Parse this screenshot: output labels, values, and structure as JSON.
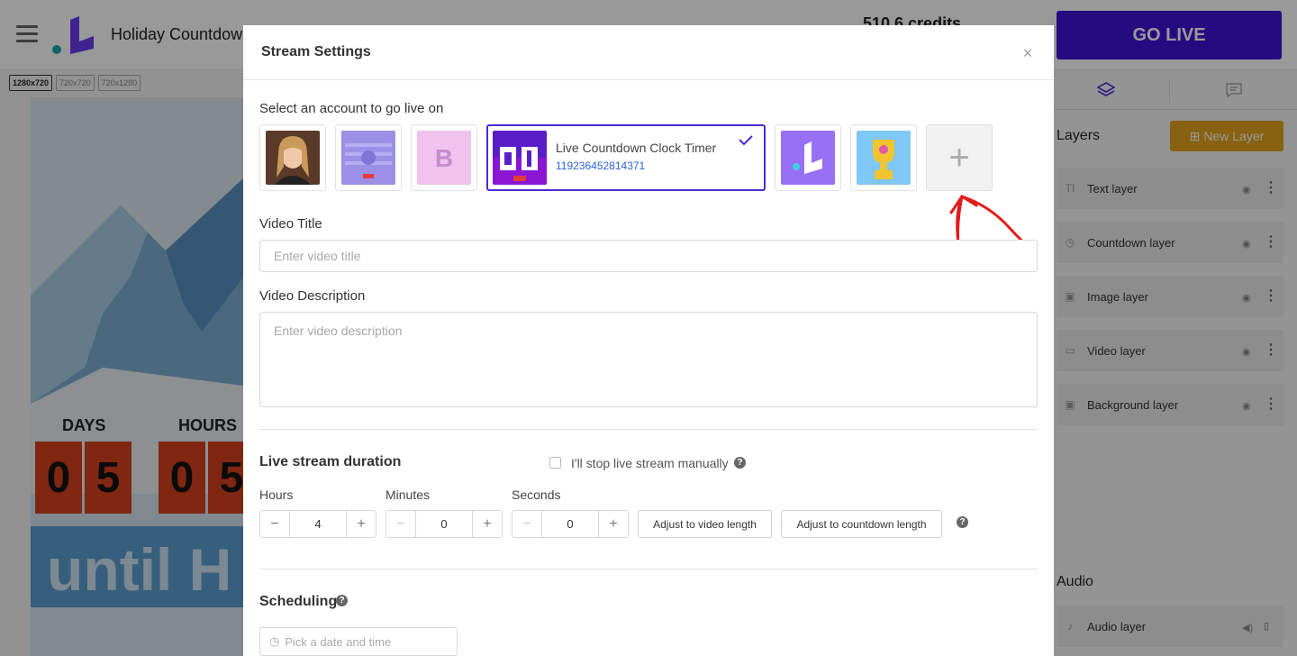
{
  "app": {
    "title": "Holiday Countdown",
    "credits": "510.6 credits",
    "go_live": "GO LIVE",
    "size_tabs": [
      "1280x720",
      "720x720",
      "720x1280"
    ],
    "canvas": {
      "days_label": "DAYS",
      "hours_label": "HOURS",
      "days_digits": [
        "0",
        "5"
      ],
      "hours_digits": [
        "0",
        "5"
      ],
      "until_text": "until H"
    },
    "sidebar": {
      "layers_title": "Layers",
      "new_layer": "New Layer",
      "layers": [
        {
          "name": "Text layer",
          "icon": "text-icon"
        },
        {
          "name": "Countdown layer",
          "icon": "clock-icon"
        },
        {
          "name": "Image layer",
          "icon": "image-icon"
        },
        {
          "name": "Video layer",
          "icon": "video-icon"
        },
        {
          "name": "Background layer",
          "icon": "image-icon"
        }
      ],
      "audio_title": "Audio",
      "audio_layer": "Audio layer"
    }
  },
  "modal": {
    "title": "Stream Settings",
    "account_label": "Select an account to go live on",
    "selected_account": {
      "name": "Live Countdown Clock Timer",
      "id": "119236452814371"
    },
    "video_title_label": "Video Title",
    "video_title_placeholder": "Enter video title",
    "video_desc_label": "Video Description",
    "video_desc_placeholder": "Enter video description",
    "duration_title": "Live stream duration",
    "manual_stop_label": "I'll stop live stream manually",
    "hours_label": "Hours",
    "minutes_label": "Minutes",
    "seconds_label": "Seconds",
    "hours_value": "4",
    "minutes_value": "0",
    "seconds_value": "0",
    "adjust_video": "Adjust to video length",
    "adjust_countdown": "Adjust to countdown length",
    "scheduling_title": "Scheduling",
    "schedule_placeholder": "Pick a date and time"
  },
  "colors": {
    "brand_purple": "#3d14d6",
    "new_layer_orange": "#e3a41d",
    "selected_border": "#4a2bd8",
    "account_id_blue": "#2a64d8"
  }
}
